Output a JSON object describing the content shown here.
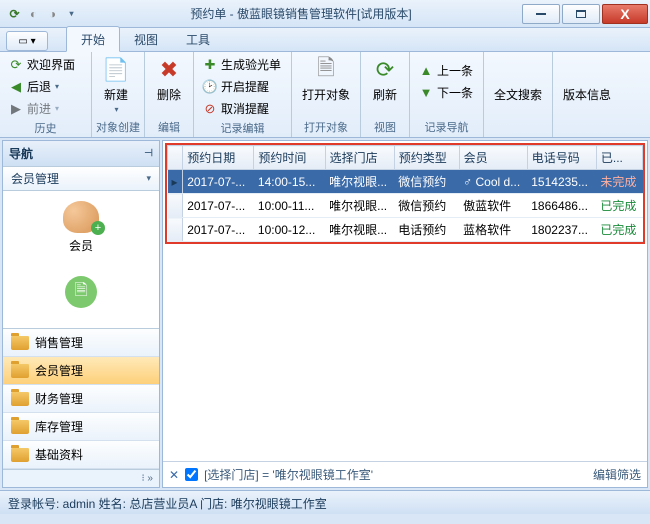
{
  "title": "预约单 - 傲蓝眼镜销售管理软件[试用版本]",
  "menu": {
    "start": "开始",
    "view": "视图",
    "tool": "工具"
  },
  "ribbon": {
    "history": {
      "welcome": "欢迎界面",
      "back": "后退",
      "forward": "前进",
      "label": "历史"
    },
    "create": {
      "new": "新建",
      "label": "对象创建"
    },
    "edit": {
      "delete": "删除",
      "label": "编辑"
    },
    "record": {
      "gen": "生成验光单",
      "remind": "开启提醒",
      "cancel": "取消提醒",
      "label": "记录编辑"
    },
    "open": {
      "open": "打开对象",
      "label": "打开对象"
    },
    "viewg": {
      "refresh": "刷新",
      "label": "视图"
    },
    "nav": {
      "prev": "上一条",
      "next": "下一条",
      "label": "记录导航"
    },
    "search": {
      "label": "全文搜索"
    },
    "version": {
      "label": "版本信息"
    }
  },
  "nav": {
    "title": "导航",
    "section": "会员管理",
    "member": "会员",
    "cats": [
      "销售管理",
      "会员管理",
      "财务管理",
      "库存管理",
      "基础资料"
    ]
  },
  "grid": {
    "cols": [
      "预约日期",
      "预约时间",
      "选择门店",
      "预约类型",
      "会员",
      "电话号码",
      "已..."
    ],
    "rows": [
      {
        "date": "2017-07-...",
        "time": "14:00-15...",
        "store": "唯尔视眼...",
        "type": "微信预约",
        "member": "♂ Cool d...",
        "phone": "1514235...",
        "status": "未完成",
        "done": false,
        "sel": true
      },
      {
        "date": "2017-07-...",
        "time": "10:00-11...",
        "store": "唯尔视眼...",
        "type": "微信预约",
        "member": "傲蓝软件",
        "phone": "1866486...",
        "status": "已完成",
        "done": true,
        "sel": false
      },
      {
        "date": "2017-07-...",
        "time": "10:00-12...",
        "store": "唯尔视眼...",
        "type": "电话预约",
        "member": "蓝格软件",
        "phone": "1802237...",
        "status": "已完成",
        "done": true,
        "sel": false
      }
    ]
  },
  "filter": {
    "text": "[选择门店] = '唯尔视眼镜工作室'",
    "edit": "编辑筛选"
  },
  "status": "登录帐号: admin  姓名: 总店营业员A    门店: 唯尔视眼镜工作室"
}
